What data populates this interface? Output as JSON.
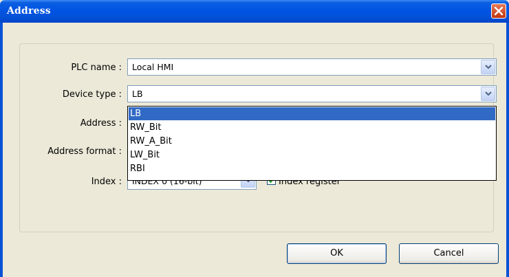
{
  "window": {
    "title": "Address"
  },
  "plc_name": {
    "label": "PLC name :",
    "value": "Local HMI"
  },
  "device_type": {
    "label": "Device type :",
    "value": "LB"
  },
  "dropdown": {
    "options": [
      "LB",
      "RW_Bit",
      "RW_A_Bit",
      "LW_Bit",
      "RBI"
    ],
    "selected": "LB"
  },
  "address": {
    "label": "Address :"
  },
  "address_format": {
    "label": "Address format :"
  },
  "index": {
    "label": "Index :",
    "value": "INDEX 0 (16-bit)"
  },
  "index_register": {
    "label": "Index register",
    "checked": true
  },
  "buttons": {
    "ok": "OK",
    "cancel": "Cancel"
  }
}
